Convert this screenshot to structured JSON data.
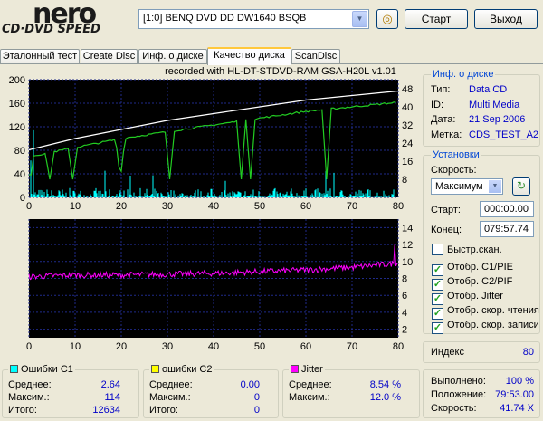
{
  "app": {
    "logo_top": "nero",
    "logo_bottom": "CD·DVD SPEED",
    "drive": "[1:0]  BENQ DVD DD DW1640 BSQB",
    "start": "Старт",
    "exit": "Выход"
  },
  "tabs": [
    "Эталонный тест",
    "Create Disc",
    "Инф. о диске",
    "Качество диска",
    "ScanDisc"
  ],
  "chart_title": "recorded with HL-DT-STDVD-RAM GSA-H20L v1.01",
  "disc_info": {
    "title": "Инф. о диске",
    "type_label": "Тип:",
    "type": "Data CD",
    "id_label": "ID:",
    "id": "Multi Media",
    "date_label": "Дата:",
    "date": "21 Sep 2006",
    "label_label": "Метка:",
    "label": "CDS_TEST_A2"
  },
  "settings": {
    "title": "Установки",
    "speed_label": "Скорость:",
    "speed": "Максимум",
    "start_label": "Старт:",
    "start": "000:00.00",
    "end_label": "Конец:",
    "end": "079:57.74",
    "quick": "Быстр.скан.",
    "show_c1": "Отобр. C1/PIE",
    "show_c2": "Отобр. C2/PIF",
    "show_jitter": "Отобр. Jitter",
    "show_read": "Отобр. скор. чтения",
    "show_write": "Отобр. скор. записи"
  },
  "index": {
    "label": "Индекс",
    "value": "80"
  },
  "progress": {
    "done_label": "Выполнено:",
    "done": "100 %",
    "pos_label": "Положение:",
    "pos": "79:53.00",
    "speed_label": "Скорость:",
    "speed": "41.74 X"
  },
  "stats": {
    "c1": {
      "title": "Ошибки C1",
      "avg_label": "Среднее:",
      "avg": "2.64",
      "max_label": "Максим.:",
      "max": "114",
      "total_label": "Итого:",
      "total": "12634"
    },
    "c2": {
      "title": "ошибки C2",
      "avg_label": "Среднее:",
      "avg": "0.00",
      "max_label": "Максим.:",
      "max": "0",
      "total_label": "Итого:",
      "total": "0"
    },
    "jitter": {
      "title": "Jitter",
      "avg_label": "Среднее:",
      "avg": "8.54 %",
      "max_label": "Максим.:",
      "max": "12.0 %"
    }
  },
  "colors": {
    "c1": "#00ffff",
    "c2": "#ffff00",
    "jitter": "#ff00ff",
    "read": "#22cc22",
    "write": "#ffffff",
    "plot_bg": "#000000",
    "accent": "#0046d5"
  },
  "chart_data": [
    {
      "type": "line",
      "x_ticks": [
        0,
        10,
        20,
        30,
        40,
        50,
        60,
        70,
        80
      ],
      "y_left_ticks": [
        0,
        40,
        80,
        120,
        160,
        200
      ],
      "y_right_ticks": [
        8,
        16,
        24,
        32,
        40,
        48
      ],
      "xlim": [
        0,
        80
      ],
      "ylim_left": [
        0,
        200
      ],
      "ylim_right": [
        0,
        52
      ],
      "series": [
        {
          "name": "C1",
          "kind": "bars",
          "avg": 2.64,
          "max": 114
        },
        {
          "kind": "line",
          "x": [
            0,
            10,
            20,
            30,
            40,
            50,
            60,
            70,
            80
          ],
          "y": [
            21,
            26,
            30,
            34,
            37,
            40,
            43,
            45,
            47
          ]
        },
        {
          "kind": "line",
          "x": [
            0,
            10,
            20,
            30,
            40,
            50,
            60,
            70,
            79.9
          ],
          "y": [
            18,
            22,
            26,
            29,
            32,
            35,
            38,
            40,
            42
          ]
        }
      ]
    },
    {
      "type": "line",
      "x_ticks": [
        0,
        10,
        20,
        30,
        40,
        50,
        60,
        70,
        80
      ],
      "y_right_ticks": [
        2,
        4,
        6,
        8,
        10,
        12,
        14
      ],
      "xlim": [
        0,
        80
      ],
      "ylim_right": [
        1,
        15
      ],
      "series": [
        {
          "name": "Jitter",
          "x": [
            0,
            10,
            20,
            30,
            40,
            50,
            60,
            70,
            80
          ],
          "y": [
            8.2,
            8.4,
            8.4,
            8.5,
            8.6,
            8.8,
            9.0,
            9.3,
            9.8
          ]
        }
      ]
    }
  ]
}
